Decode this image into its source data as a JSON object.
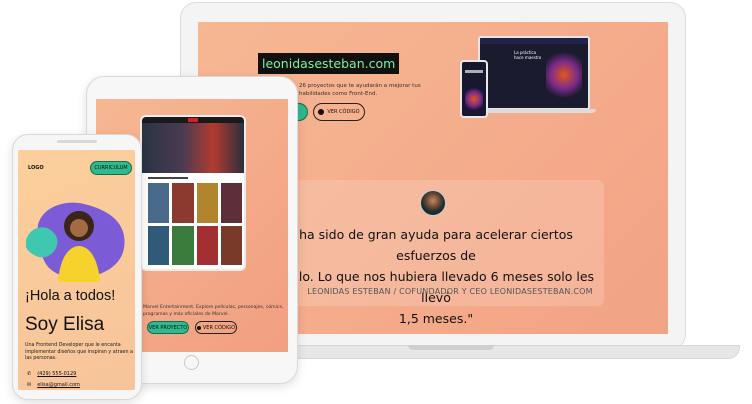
{
  "laptop": {
    "site_badge": "leonidasesteban.com",
    "description": "26 proyectos que te ayudarán a mejorar tus habilidades como Front-End.",
    "code_button": "VER CÓDIGO",
    "mini_site_heading": "La práctica hace maestro",
    "testimonial": {
      "quote_line1": "ha sido de gran ayuda para acelerar ciertos esfuerzos de",
      "quote_line2": "rrollo. Lo que nos hubiera llevado 6 meses solo les llevó",
      "quote_line3": "1,5 meses.\"",
      "author": "LEONIDAS ESTEBAN / COFUNDADOR Y CEO LEONIDASESTEBAN.COM"
    }
  },
  "tablet": {
    "description": "Marvel Entertainment. Explore películas, personajes, cómics, programas y más oficiales de Marvel.",
    "project_button": "VER PROYECTO",
    "code_button": "VER CÓDIGO"
  },
  "phone": {
    "logo": "LOGO",
    "cv_button": "CURRICULUM",
    "hello": "¡Hola a todos!",
    "name": "Soy Elisa",
    "bio": "Una Frontend Developer que le encanta implementar diseños que inspiran y atraen a las personas.",
    "phone_number": "(429) 555-0129",
    "email": "elisa@gmail.com"
  },
  "colors": {
    "peach_background": "#f4a98a",
    "accent_green": "#2fb98d",
    "hero_blob": "#7b5cd6",
    "hero_accent": "#3fc7b0"
  }
}
